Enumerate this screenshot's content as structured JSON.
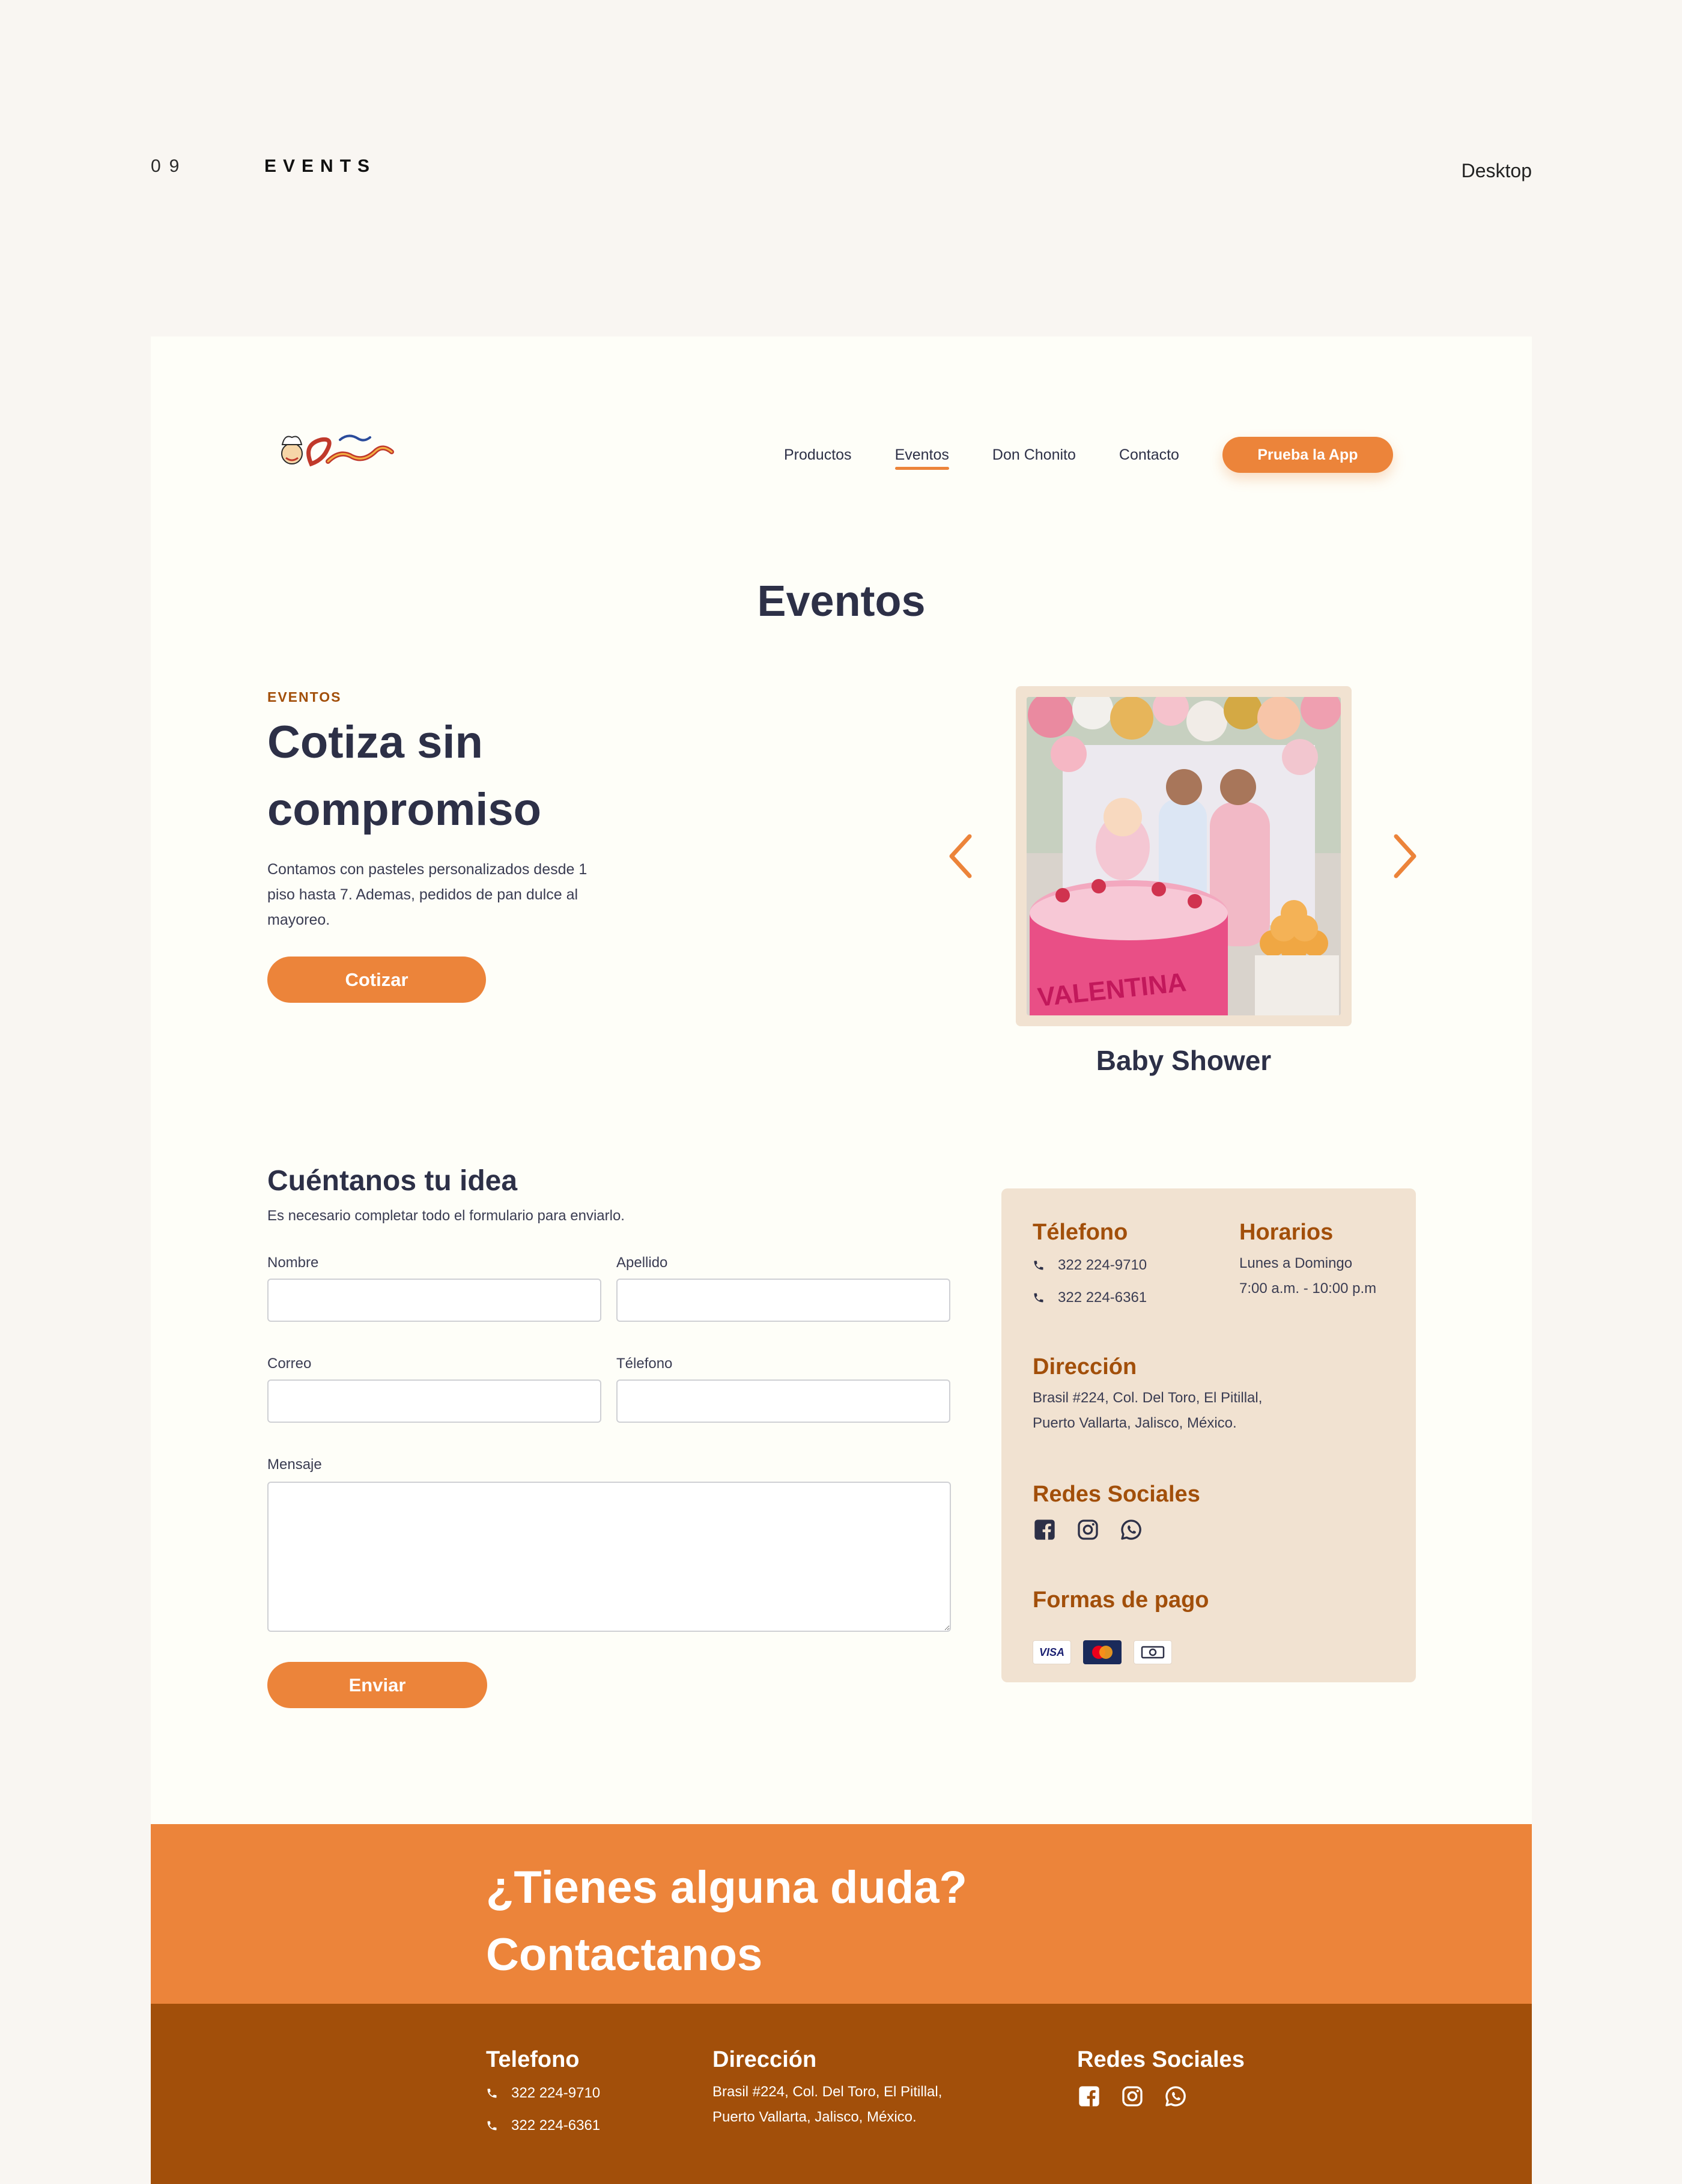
{
  "presentation": {
    "number": "09",
    "section": "EVENTS",
    "device": "Desktop"
  },
  "header": {
    "nav": [
      {
        "label": "Productos",
        "active": false
      },
      {
        "label": "Eventos",
        "active": true
      },
      {
        "label": "Don Chonito",
        "active": false
      },
      {
        "label": "Contacto",
        "active": false
      }
    ],
    "cta_label": "Prueba la App"
  },
  "page_title": "Eventos",
  "hero": {
    "eyebrow": "EVENTOS",
    "title_line1": "Cotiza sin",
    "title_line2": "compromiso",
    "description": "Contamos con pasteles personalizados desde 1 piso hasta 7. Ademas, pedidos de pan dulce al mayoreo.",
    "button_label": "Cotizar"
  },
  "carousel": {
    "caption": "Baby Shower",
    "cake_text": "VALENTINA"
  },
  "form": {
    "title": "Cuéntanos tu idea",
    "note": "Es necesario completar todo el formulario para  enviarlo.",
    "fields": {
      "nombre": "Nombre",
      "apellido": "Apellido",
      "correo": "Correo",
      "telefono": "Télefono",
      "mensaje": "Mensaje"
    },
    "submit_label": "Enviar"
  },
  "info": {
    "phone_title": "Télefono",
    "phones": [
      "322 224-9710",
      "322 224-6361"
    ],
    "hours_title": "Horarios",
    "hours_line1": "Lunes a Domingo",
    "hours_line2": "7:00 a.m. - 10:00 p.m",
    "address_title": "Dirección",
    "address_line1": "Brasil #224, Col. Del Toro, El Pitillal,",
    "address_line2": "Puerto Vallarta, Jalisco, México.",
    "social_title": "Redes Sociales",
    "payment_title": "Formas de pago",
    "visa_label": "VISA"
  },
  "cta": {
    "line1": "¿Tienes alguna duda?",
    "line2": "Contactanos"
  },
  "footer": {
    "phone_title": "Telefono",
    "phones": [
      "322 224-9710",
      "322 224-6361"
    ],
    "address_title": "Dirección",
    "address_line1": "Brasil #224, Col. Del Toro, El Pitillal,",
    "address_line2": "Puerto Vallarta, Jalisco, México.",
    "social_title": "Redes Sociales"
  },
  "colors": {
    "accent": "#ec843a",
    "brown": "#a24f0a",
    "navy": "#2d3047",
    "cream": "#f1e2d1"
  }
}
